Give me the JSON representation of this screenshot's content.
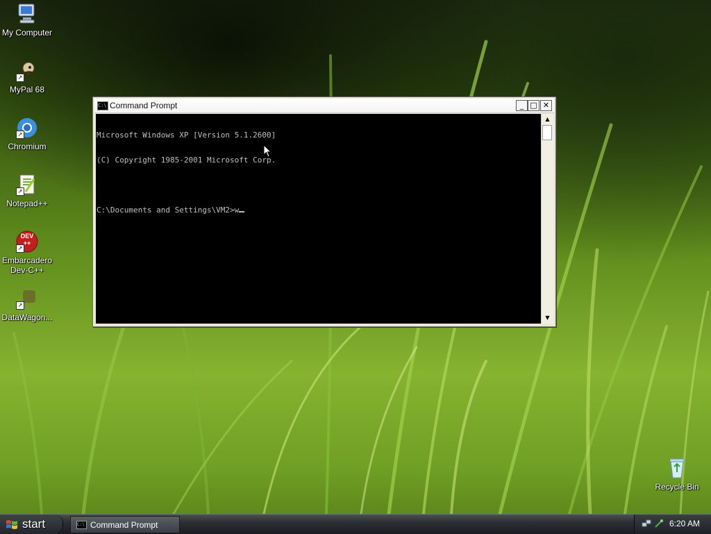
{
  "desktop": {
    "icons": [
      {
        "label": "My Computer",
        "icon": "my-computer-icon"
      },
      {
        "label": "MyPal 68",
        "icon": "mypal-icon"
      },
      {
        "label": "Chromium",
        "icon": "chromium-icon"
      },
      {
        "label": "Notepad++",
        "icon": "notepadpp-icon"
      },
      {
        "label": "Embarcadero Dev-C++",
        "icon": "devcpp-icon"
      },
      {
        "label": "DataWagon...",
        "icon": "datawagon-icon"
      },
      {
        "label": "Recycle Bin",
        "icon": "recycle-bin-icon"
      }
    ],
    "devcpp_badge_text": "DEV",
    "devcpp_badge_sub": "++"
  },
  "window": {
    "title": "Command Prompt",
    "icon_text": "C:\\",
    "buttons": {
      "minimize": "_",
      "maximize": "□",
      "close": "✕"
    },
    "console_lines": [
      "Microsoft Windows XP [Version 5.1.2600]",
      "(C) Copyright 1985-2001 Microsoft Corp.",
      "",
      "C:\\Documents and Settings\\VM2>w"
    ],
    "scroll_up": "▲",
    "scroll_down": "▼"
  },
  "taskbar": {
    "start_label": "start",
    "tasks": [
      {
        "label": "Command Prompt",
        "icon_text": "C:\\"
      }
    ],
    "clock": "6:20 AM"
  },
  "colors": {
    "console_bg": "#000000",
    "console_fg": "#c0c0c0",
    "taskbar": "#2b2e33"
  }
}
